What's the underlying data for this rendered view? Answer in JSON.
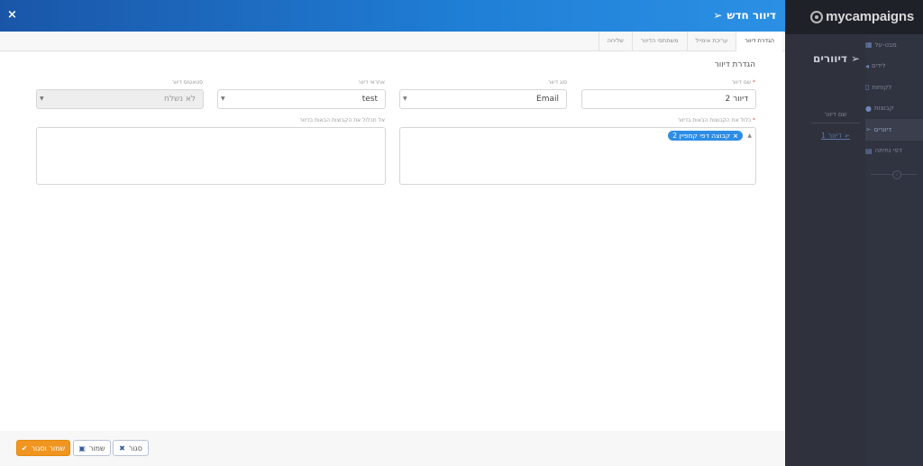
{
  "background_app": {
    "logo": "mycampaigns",
    "page_title": "דיוורים",
    "sidebar": [
      {
        "label": "מבט-על",
        "icon": "dashboard-icon",
        "active": false
      },
      {
        "label": "לידים",
        "icon": "megaphone-icon",
        "active": false
      },
      {
        "label": "לקוחות",
        "icon": "contacts-icon",
        "active": false
      },
      {
        "label": "קבוצות",
        "icon": "users-icon",
        "active": false
      },
      {
        "label": "דיוורים",
        "icon": "paper-plane-icon",
        "active": true
      },
      {
        "label": "דפי נחיתה",
        "icon": "page-icon",
        "active": false
      }
    ],
    "table_header": "שם דיוור",
    "table_row": "דיוור 1"
  },
  "modal": {
    "title": "דיוור חדש",
    "close_icon": "×",
    "tabs": [
      "הגדרת דיוור",
      "עריכת אימייל",
      "משתתפי הדיוור",
      "שליחה"
    ],
    "active_tab": 0,
    "section_title": "הגדרת דיוור",
    "fields": {
      "name": {
        "label": "שם דיוור",
        "required_mark": "*",
        "value": "דיוור 2"
      },
      "type": {
        "label": "סוג דיוור",
        "value": "Email"
      },
      "template": {
        "label": "אחראי דיוור",
        "value": "test"
      },
      "status": {
        "label": "סטאטוס דיוור",
        "value": "לא נשלח"
      },
      "include_groups": {
        "label": "כלול את הקבוצות הבאות בדיוור",
        "required_mark": "*",
        "tags": [
          "קבוצה דפי קמפיין 2"
        ]
      },
      "exclude_groups": {
        "label": "אל תכלול את הקבוצות הבאות בדיוור"
      }
    }
  },
  "footer": {
    "save_close_label": "שמור וסגור",
    "save_label": "שמור",
    "close_label": "סגור"
  },
  "colors": {
    "header_gradient_start": "#1a56a8",
    "header_gradient_end": "#2b90e4",
    "tag_blue": "#2d8de6",
    "primary_orange": "#f0951f",
    "background_dark": "#2b2e38"
  }
}
